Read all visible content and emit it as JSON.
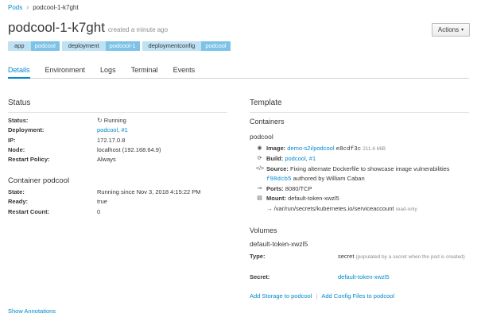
{
  "breadcrumb": {
    "parent": "Pods",
    "current": "podcool-1-k7ght"
  },
  "header": {
    "title": "podcool-1-k7ght",
    "created": "created a minute ago",
    "actions_label": "Actions"
  },
  "labels": [
    {
      "key": "app",
      "value": "podcool"
    },
    {
      "key": "deployment",
      "value": "podcool-1"
    },
    {
      "key": "deploymentconfig",
      "value": "podcool"
    }
  ],
  "tabs": [
    "Details",
    "Environment",
    "Logs",
    "Terminal",
    "Events"
  ],
  "status": {
    "heading": "Status",
    "status_label": "Status:",
    "status_value": "Running",
    "deployment_label": "Deployment:",
    "deployment_name": "podcool",
    "deployment_num": "#1",
    "ip_label": "IP:",
    "ip_value": "172.17.0.8",
    "node_label": "Node:",
    "node_value": "localhost (192.168.64.9)",
    "restart_label": "Restart Policy:",
    "restart_value": "Always"
  },
  "container": {
    "heading": "Container podcool",
    "state_label": "State:",
    "state_value": "Running since Nov 3, 2018 4:15:22 PM",
    "ready_label": "Ready:",
    "ready_value": "true",
    "restart_count_label": "Restart Count:",
    "restart_count_value": "0"
  },
  "show_annotations": "Show Annotations",
  "template": {
    "heading": "Template",
    "containers_heading": "Containers",
    "container_name": "podcool",
    "image_label": "Image:",
    "image_link": "demo-s2i/podcool",
    "image_hash": "e8cdf3c",
    "image_size": "211.6 MiB",
    "build_label": "Build:",
    "build_name": "podcool",
    "build_num": "#1",
    "source_label": "Source:",
    "source_text": "Fixing alternate Dockerfile to showcase image vulnerabilities",
    "source_hash": "f98dcb5",
    "source_author": "authored by William Caban",
    "ports_label": "Ports:",
    "ports_value": "8080/TCP",
    "mount_label": "Mount:",
    "mount_value": "default-token-xwzl5",
    "mount_path": "→ /var/run/secrets/kubernetes.io/serviceaccount",
    "mount_mode": "read-only",
    "volumes_heading": "Volumes",
    "volume_name": "default-token-xwzl5",
    "type_label": "Type:",
    "type_value": "secret",
    "type_note": "(populated by a secret when the pod is created)",
    "secret_label": "Secret:",
    "secret_value": "default-token-xwzl5",
    "add_storage": "Add Storage to podcool",
    "add_config": "Add Config Files to podcool",
    "link_sep": "|"
  }
}
